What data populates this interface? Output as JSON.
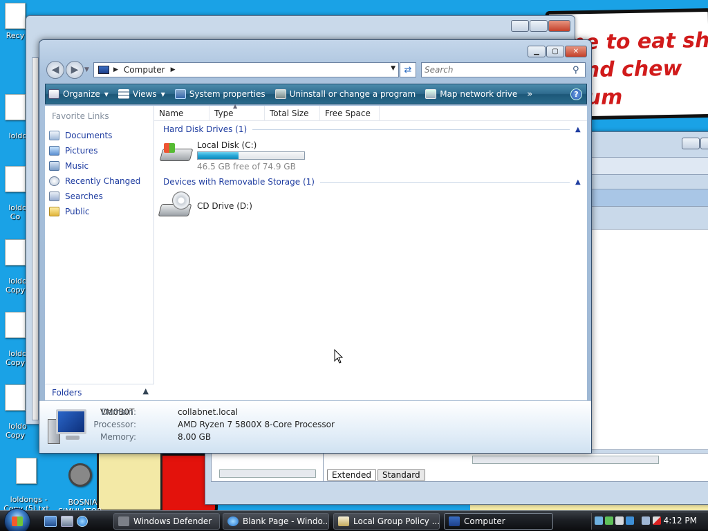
{
  "desktop": {
    "wallpaper_text": "me to eat shit\n and chew\n gum",
    "icons": [
      {
        "label": "Recy",
        "kind": "doc"
      },
      {
        "label": "loldc",
        "kind": "doc"
      },
      {
        "label": "loldo\nCo",
        "kind": "doc"
      },
      {
        "label": "loldo\nCopy",
        "kind": "doc"
      },
      {
        "label": "loldo\nCopy",
        "kind": "doc"
      },
      {
        "label": "loldo\nCopy",
        "kind": "doc"
      },
      {
        "label": "loldongs -\nCopy (5).txt",
        "kind": "doc"
      },
      {
        "label": "BOSNIA\nSIMULATOR",
        "kind": "app"
      }
    ]
  },
  "background_window": {
    "tabs": [
      "Extended",
      "Standard"
    ]
  },
  "explorer": {
    "title_buttons": {
      "minimize": "▁",
      "maximize": "▢",
      "close": "✕"
    },
    "address": {
      "crumb": "Computer"
    },
    "search": {
      "placeholder": "Search"
    },
    "toolbar": {
      "organize": "Organize",
      "views": "Views",
      "system_properties": "System properties",
      "uninstall": "Uninstall or change a program",
      "map_drive": "Map network drive",
      "more": "»",
      "help": "?"
    },
    "nav": {
      "heading": "Favorite Links",
      "items": [
        "Documents",
        "Pictures",
        "Music",
        "Recently Changed",
        "Searches",
        "Public"
      ],
      "folders": "Folders"
    },
    "columns": [
      "Name",
      "Type",
      "Total Size",
      "Free Space"
    ],
    "groups": {
      "hdd": "Hard Disk Drives (1)",
      "removable": "Devices with Removable Storage (1)"
    },
    "drives": {
      "c_name": "Local Disk (C:)",
      "c_free": "46.5 GB free of 74.9 GB",
      "c_used_fraction": 0.38,
      "d_name": "CD Drive (D:)"
    },
    "details": {
      "computer_name": "VM0B0T",
      "domain_label": "Domain:",
      "domain": "collabnet.local",
      "processor_label": "Processor:",
      "processor": "AMD Ryzen 7 5800X 8-Core Processor",
      "memory_label": "Memory:",
      "memory": "8.00 GB"
    }
  },
  "taskbar": {
    "tasks": [
      {
        "label": "Windows Defender",
        "active": false
      },
      {
        "label": "Blank Page - Windo...",
        "active": false
      },
      {
        "label": "Local Group Policy ...",
        "active": false
      },
      {
        "label": "Computer",
        "active": true
      }
    ],
    "clock": "4:12 PM"
  }
}
